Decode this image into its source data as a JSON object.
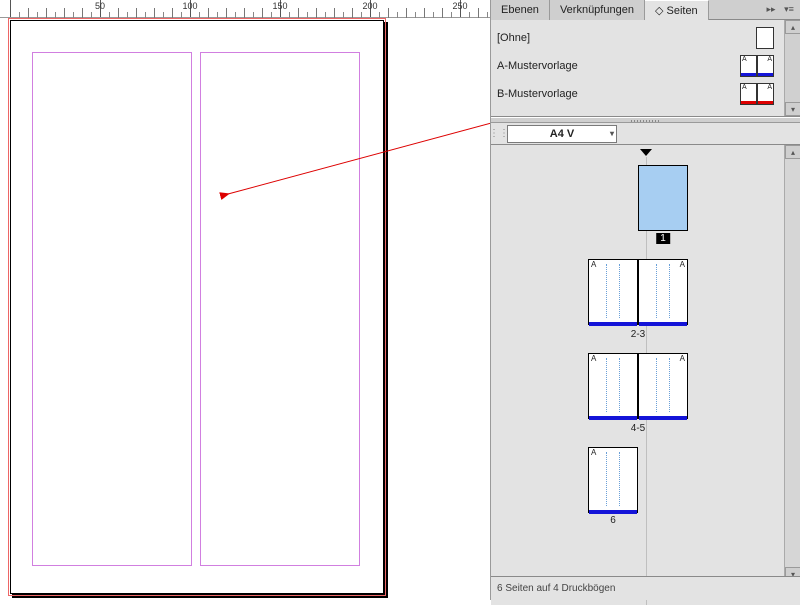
{
  "ruler": {
    "major": [
      50,
      100,
      150,
      200,
      250
    ]
  },
  "tabs": {
    "layers": "Ebenen",
    "links": "Verknüpfungen",
    "pages": "Seiten",
    "pages_prefix": "◇"
  },
  "masters": [
    {
      "label": "[Ohne]",
      "type": "single",
      "bar": "none",
      "prefix": ""
    },
    {
      "label": "A-Mustervorlage",
      "type": "double",
      "bar": "blue",
      "prefix": "A"
    },
    {
      "label": "B-Mustervorlage",
      "type": "double",
      "bar": "red",
      "prefix": "A"
    }
  ],
  "page_size": {
    "label": "A4 V"
  },
  "spreads": [
    {
      "kind": "single",
      "label": "1",
      "selected": true,
      "master": "",
      "bar": "none"
    },
    {
      "kind": "double",
      "label": "2-3",
      "master": "A",
      "bar": "blue"
    },
    {
      "kind": "double",
      "label": "4-5",
      "master": "A",
      "bar": "blue"
    },
    {
      "kind": "single-left",
      "label": "6",
      "master": "A",
      "bar": "blue"
    }
  ],
  "status_text": "6 Seiten auf 4 Druckbögen"
}
